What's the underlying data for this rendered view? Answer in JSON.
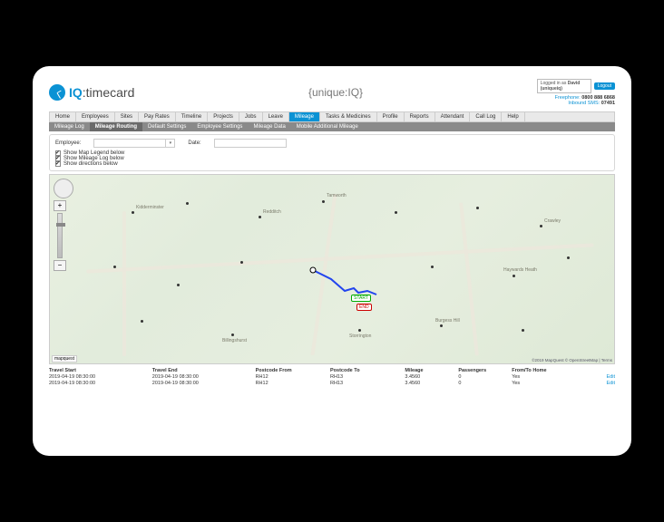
{
  "brand": {
    "prefix": "IQ",
    "suffix": ":timecard",
    "center": "{unique:IQ}"
  },
  "auth": {
    "logged_in_prefix": "Logged in as",
    "user_name": "David",
    "user_sub": "(uniqueiq)",
    "logout": "Logout"
  },
  "contact": {
    "freephone_label": "Freephone:",
    "freephone": "0800 888 6868",
    "sms_label": "Inbound SMS:",
    "sms": "07491"
  },
  "nav": {
    "main": [
      "Home",
      "Employees",
      "Sites",
      "Pay Rates",
      "Timeline",
      "Projects",
      "Jobs",
      "Leave",
      "Mileage",
      "Tasks & Medicines",
      "Profile",
      "Reports",
      "Attendant",
      "Call Log",
      "Help"
    ],
    "main_active": 8,
    "sub": [
      "Mileage Log",
      "Mileage Routing",
      "Default Settings",
      "Employee Settings",
      "Mileage Data",
      "Mobile Additional Mileage"
    ],
    "sub_active": 1
  },
  "filters": {
    "employee_label": "Employee:",
    "date_label": "Date:",
    "checks": [
      "Show Map Legend below",
      "Show Mileage Log below",
      "Show directions below"
    ]
  },
  "map": {
    "start_label": "START",
    "end_label": "END",
    "attribution": "©2019 MapQuest © OpenStreetMap | Terms",
    "provider": "mapquest",
    "towns": [
      "Kidderminster",
      "Redditch",
      "Tamworth",
      "Crawley",
      "Billingshurst",
      "Storrington",
      "Haywards Heath",
      "Burgess Hill"
    ]
  },
  "table": {
    "headers": [
      "Travel Start",
      "Travel End",
      "Postcode From",
      "Postcode To",
      "Mileage",
      "Passengers",
      "From/To Home",
      ""
    ],
    "rows": [
      [
        "2019-04-19 08:30:00",
        "2019-04-19 08:30:00",
        "RH12",
        "RH13",
        "3.4560",
        "0",
        "Yes",
        "Edit"
      ],
      [
        "2019-04-19 08:30:00",
        "2019-04-19 08:30:00",
        "RH12",
        "RH13",
        "3.4560",
        "0",
        "Yes",
        "Edit"
      ]
    ]
  }
}
